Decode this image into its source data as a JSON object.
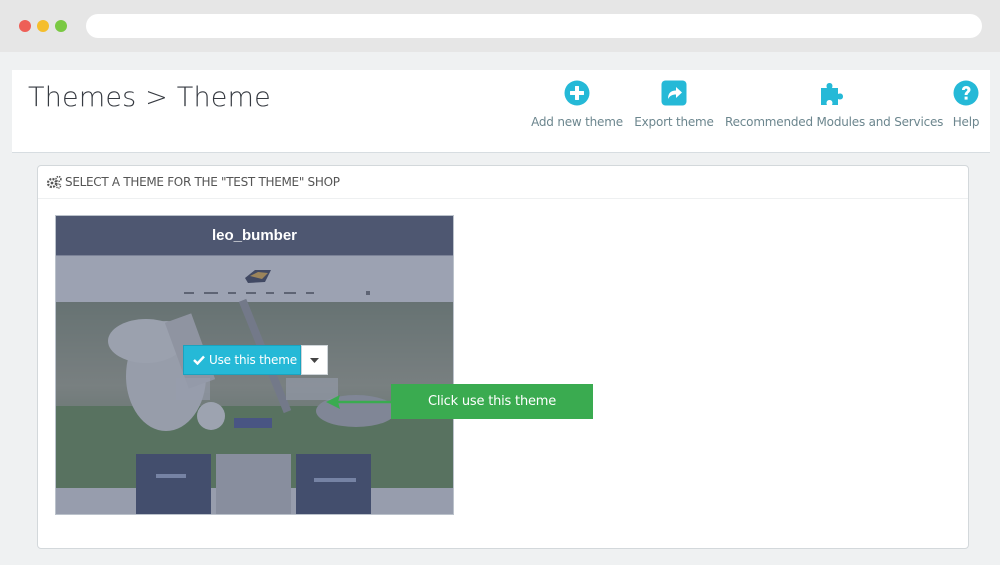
{
  "header": {
    "title": "Themes > Theme",
    "toolbar": [
      {
        "label": "Add new theme",
        "icon": "plus-circle-icon"
      },
      {
        "label": "Export theme",
        "icon": "share-icon"
      },
      {
        "label": "Recommended Modules and Services",
        "icon": "puzzle-icon"
      },
      {
        "label": "Help",
        "icon": "question-circle-icon"
      }
    ]
  },
  "panel": {
    "heading": "SELECT A THEME FOR THE \"TEST THEME\" SHOP",
    "theme": {
      "name": "leo_bumber",
      "use_button_label": "Use this theme"
    }
  },
  "annotation": {
    "callout_text": "Click use this theme"
  },
  "colors": {
    "accent": "#25b9d7",
    "callout": "#3aab50",
    "card_header": "#4e5771"
  }
}
